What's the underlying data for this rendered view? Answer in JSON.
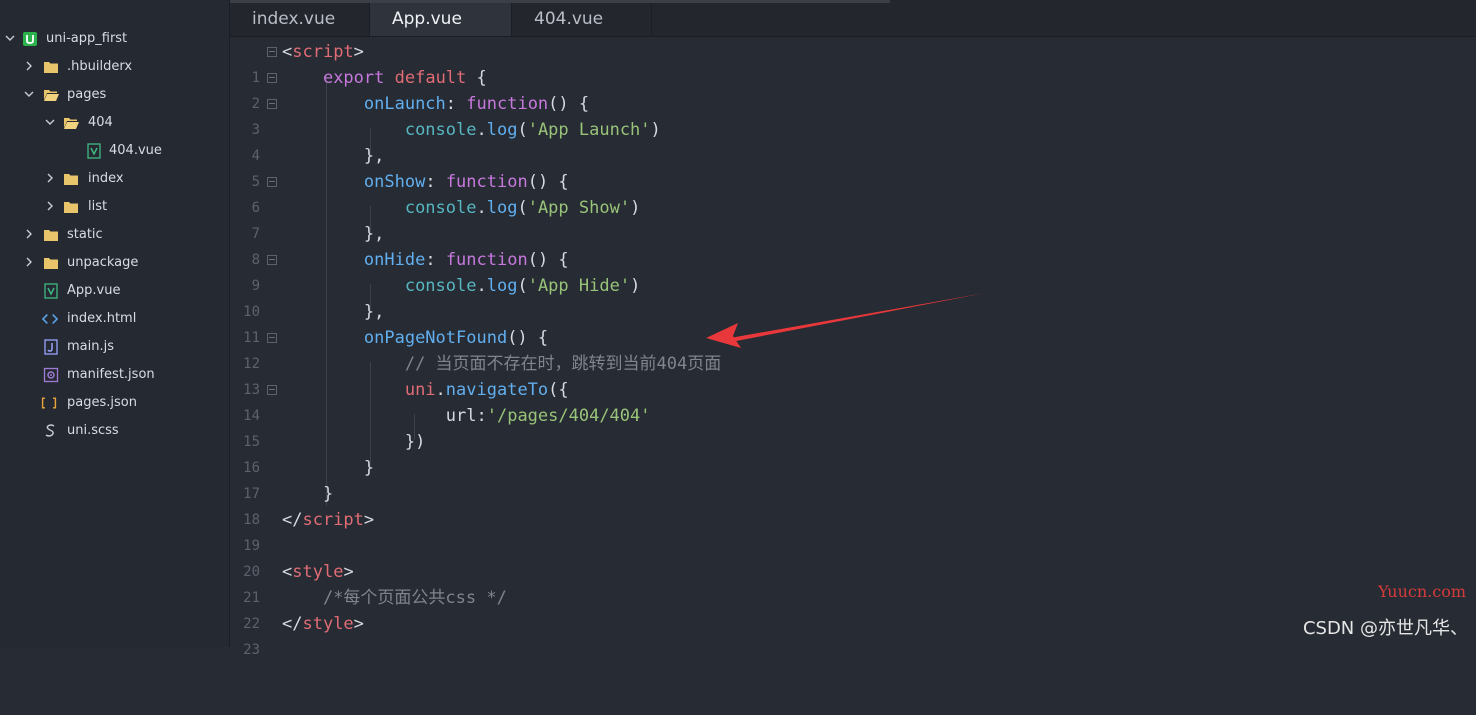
{
  "project": {
    "root": "uni-app_first",
    "items": [
      {
        "label": ".hbuilderx"
      },
      {
        "label": "pages"
      },
      {
        "label": "404"
      },
      {
        "label": "404.vue"
      },
      {
        "label": "index"
      },
      {
        "label": "list"
      },
      {
        "label": "static"
      },
      {
        "label": "unpackage"
      },
      {
        "label": "App.vue"
      },
      {
        "label": "index.html"
      },
      {
        "label": "main.js"
      },
      {
        "label": "manifest.json"
      },
      {
        "label": "pages.json"
      },
      {
        "label": "uni.scss"
      }
    ]
  },
  "tabs": [
    {
      "label": "index.vue"
    },
    {
      "label": "App.vue",
      "active": true
    },
    {
      "label": "404.vue"
    }
  ],
  "editor": {
    "line_numbers": [
      "1",
      "2",
      "3",
      "4",
      "5",
      "6",
      "7",
      "8",
      "9",
      "10",
      "11",
      "12",
      "13",
      "14",
      "15",
      "16",
      "17",
      "18",
      "19",
      "20",
      "21",
      "22",
      "23"
    ],
    "tokens": {
      "l1_a": "<",
      "l1_b": "script",
      "l1_c": ">",
      "l2_a": "export",
      "l2_b": "default",
      "l2_c": "{",
      "l3_a": "onLaunch",
      "l3_b": ":",
      "l3_c": "function",
      "l3_d": "() {",
      "l4_a": "console",
      "l4_b": ".",
      "l4_c": "log",
      "l4_d": "(",
      "l4_e": "'App Launch'",
      "l4_f": ")",
      "l5_a": "},",
      "l6_a": "onShow",
      "l6_b": ":",
      "l6_c": "function",
      "l6_d": "() {",
      "l7_a": "console",
      "l7_b": ".",
      "l7_c": "log",
      "l7_d": "(",
      "l7_e": "'App Show'",
      "l7_f": ")",
      "l8_a": "},",
      "l9_a": "onHide",
      "l9_b": ":",
      "l9_c": "function",
      "l9_d": "() {",
      "l10_a": "console",
      "l10_b": ".",
      "l10_c": "log",
      "l10_d": "(",
      "l10_e": "'App Hide'",
      "l10_f": ")",
      "l11_a": "},",
      "l12_a": "onPageNotFound",
      "l12_b": "() {",
      "l13_a": "// 当页面不存在时，跳转到当前404页面",
      "l14_a": "uni",
      "l14_b": ".",
      "l14_c": "navigateTo",
      "l14_d": "({",
      "l15_a": "url",
      "l15_b": ":",
      "l15_c": "'/pages/404/404'",
      "l16_a": "})",
      "l17_a": "}",
      "l18_a": "}",
      "l19_a": "</",
      "l19_b": "script",
      "l19_c": ">",
      "l21_a": "<",
      "l21_b": "style",
      "l21_c": ">",
      "l22_a": "/*每个页面公共css */",
      "l23_a": "</",
      "l23_b": "style",
      "l23_c": ">"
    }
  },
  "watermarks": {
    "site": "Yuucn.com",
    "author": "CSDN @亦世凡华、"
  },
  "colors": {
    "annotation_arrow": "#e8383b"
  }
}
